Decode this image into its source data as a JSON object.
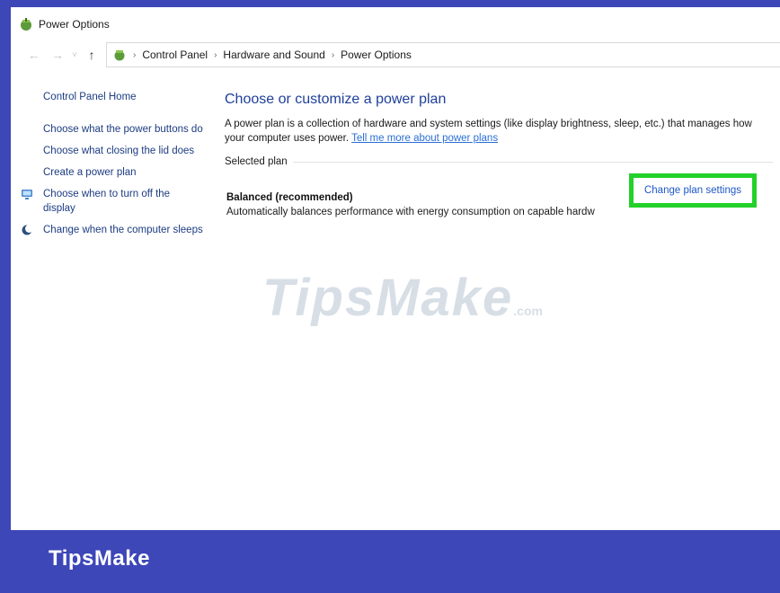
{
  "window": {
    "title": "Power Options"
  },
  "nav": {
    "back_glyph": "←",
    "forward_glyph": "→",
    "dropdown_glyph": "˅",
    "up_glyph": "↑",
    "separator": "›",
    "breadcrumbs": [
      "Control Panel",
      "Hardware and Sound",
      "Power Options"
    ]
  },
  "sidebar": {
    "home": "Control Panel Home",
    "links": [
      "Choose what the power buttons do",
      "Choose what closing the lid does",
      "Create a power plan",
      "Choose when to turn off the display",
      "Change when the computer sleeps"
    ]
  },
  "main": {
    "heading": "Choose or customize a power plan",
    "description": "A power plan is a collection of hardware and system settings (like display brightness, sleep, etc.) that manages how your computer uses power.",
    "learn_more": "Tell me more about power plans",
    "selected_plan_label": "Selected plan",
    "plan_name": "Balanced (recommended)",
    "plan_description": "Automatically balances performance with energy consumption on capable hardw",
    "change_plan": "Change plan settings"
  },
  "watermark": {
    "main": "TipsMake",
    "suffix": ".com"
  },
  "footer": {
    "brand": "TipsMake"
  },
  "colors": {
    "highlight": "#23d12a",
    "link": "#1e58c6",
    "frame": "#3d47b8"
  },
  "icons": [
    "power-options-icon",
    "control-panel-icon",
    "monitor-icon",
    "moon-icon"
  ]
}
